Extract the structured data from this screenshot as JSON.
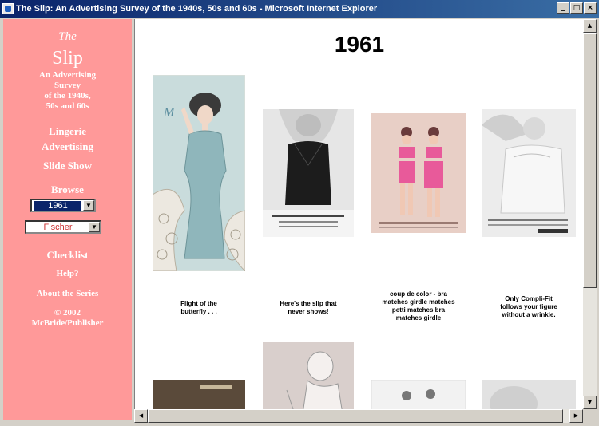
{
  "window": {
    "title": "The Slip: An Advertising Survey of the 1940s, 50s and 60s - Microsoft Internet Explorer",
    "min_label": "_",
    "max_label": "□",
    "close_label": "×"
  },
  "nav": {
    "the": "The",
    "slip": "Slip",
    "subtitle_lines": [
      "An Advertising",
      "Survey",
      "of the 1940s,",
      "50s and 60s"
    ],
    "lingerie_lines": [
      "Lingerie",
      "Advertising"
    ],
    "slide_show": "Slide Show",
    "browse": "Browse",
    "year_select": "1961",
    "brand_select": "Fischer",
    "checklist": "Checklist",
    "help": "Help?",
    "about": "About the Series",
    "copyright_lines": [
      "© 2002",
      "McBride/Publisher"
    ]
  },
  "content": {
    "year_heading": "1961",
    "ads": [
      {
        "caption_lines": [
          "Flight of the",
          "butterfly . . ."
        ]
      },
      {
        "caption_lines": [
          "Here's the slip that",
          "never shows!"
        ]
      },
      {
        "caption_lines": [
          "coup de color - bra",
          "matches girdle matches",
          "petti matches bra",
          "matches girdle"
        ]
      },
      {
        "caption_lines": [
          "Only Compli-Fit",
          "follows your figure",
          "without a wrinkle."
        ]
      }
    ]
  },
  "colors": {
    "nav_background": "#ff9999",
    "titlebar": "#0a246a",
    "content_background": "#ffffff"
  },
  "icons": {
    "scroll_up": "▲",
    "scroll_down": "▼",
    "scroll_left": "◀",
    "scroll_right": "▶",
    "dropdown": "▼"
  }
}
